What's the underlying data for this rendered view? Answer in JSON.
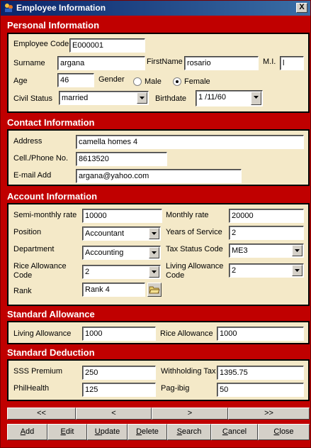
{
  "window": {
    "title": "Employee Information",
    "close_label": "X"
  },
  "personal": {
    "heading": "Personal Information",
    "employee_code_label": "Employee Code",
    "employee_code": "E000001",
    "surname_label": "Surname",
    "surname": "argana",
    "firstname_label": "FirstName",
    "firstname": "rosario",
    "mi_label": "M.I.",
    "mi": "l",
    "age_label": "Age",
    "age": "46",
    "gender_label": "Gender",
    "gender_options": [
      "Male",
      "Female"
    ],
    "gender_selected": "Female",
    "civil_status_label": "Civil Status",
    "civil_status": "married",
    "birthdate_label": "Birthdate",
    "birthdate": "1 /11/60"
  },
  "contact": {
    "heading": "Contact Information",
    "address_label": "Address",
    "address": "camella homes 4",
    "phone_label": "Cell./Phone No.",
    "phone": "8613520",
    "email_label": "E-mail Add",
    "email": "argana@yahoo.com"
  },
  "account": {
    "heading": "Account Information",
    "semi_monthly_label": "Semi-monthly rate",
    "semi_monthly": "10000",
    "monthly_label": "Monthly rate",
    "monthly": "20000",
    "position_label": "Position",
    "position": "Accountant",
    "years_label": "Years of Service",
    "years": "2",
    "department_label": "Department",
    "department": "Accounting",
    "tax_label": "Tax Status Code",
    "tax": "ME3",
    "rice_code_label_1": "Rice Allowance",
    "rice_code_label_2": "Code",
    "rice_code": "2",
    "living_code_label_1": "Living Allowance",
    "living_code_label_2": "Code",
    "living_code": "2",
    "rank_label": "Rank",
    "rank": "Rank 4"
  },
  "allowance": {
    "heading": "Standard Allowance",
    "living_label": "Living Allowance",
    "living": "1000",
    "rice_label": "Rice Allowance",
    "rice": "1000"
  },
  "deduction": {
    "heading": "Standard Deduction",
    "sss_label": "SSS Premium",
    "sss": "250",
    "withholding_label": "Withholding Tax",
    "withholding": "1395.75",
    "philhealth_label": "PhilHealth",
    "philhealth": "125",
    "pagibig_label": "Pag-ibig",
    "pagibig": "50"
  },
  "nav": {
    "first": "<<",
    "prev": "<",
    "next": ">",
    "last": ">>"
  },
  "actions": {
    "add": "Add",
    "edit": "Edit",
    "update": "Update",
    "delete": "Delete",
    "search": "Search",
    "cancel": "Cancel",
    "close": "Close"
  },
  "colors": {
    "background": "#c00000",
    "panel": "#f4e9c8",
    "titlebar": "#0a246a"
  }
}
